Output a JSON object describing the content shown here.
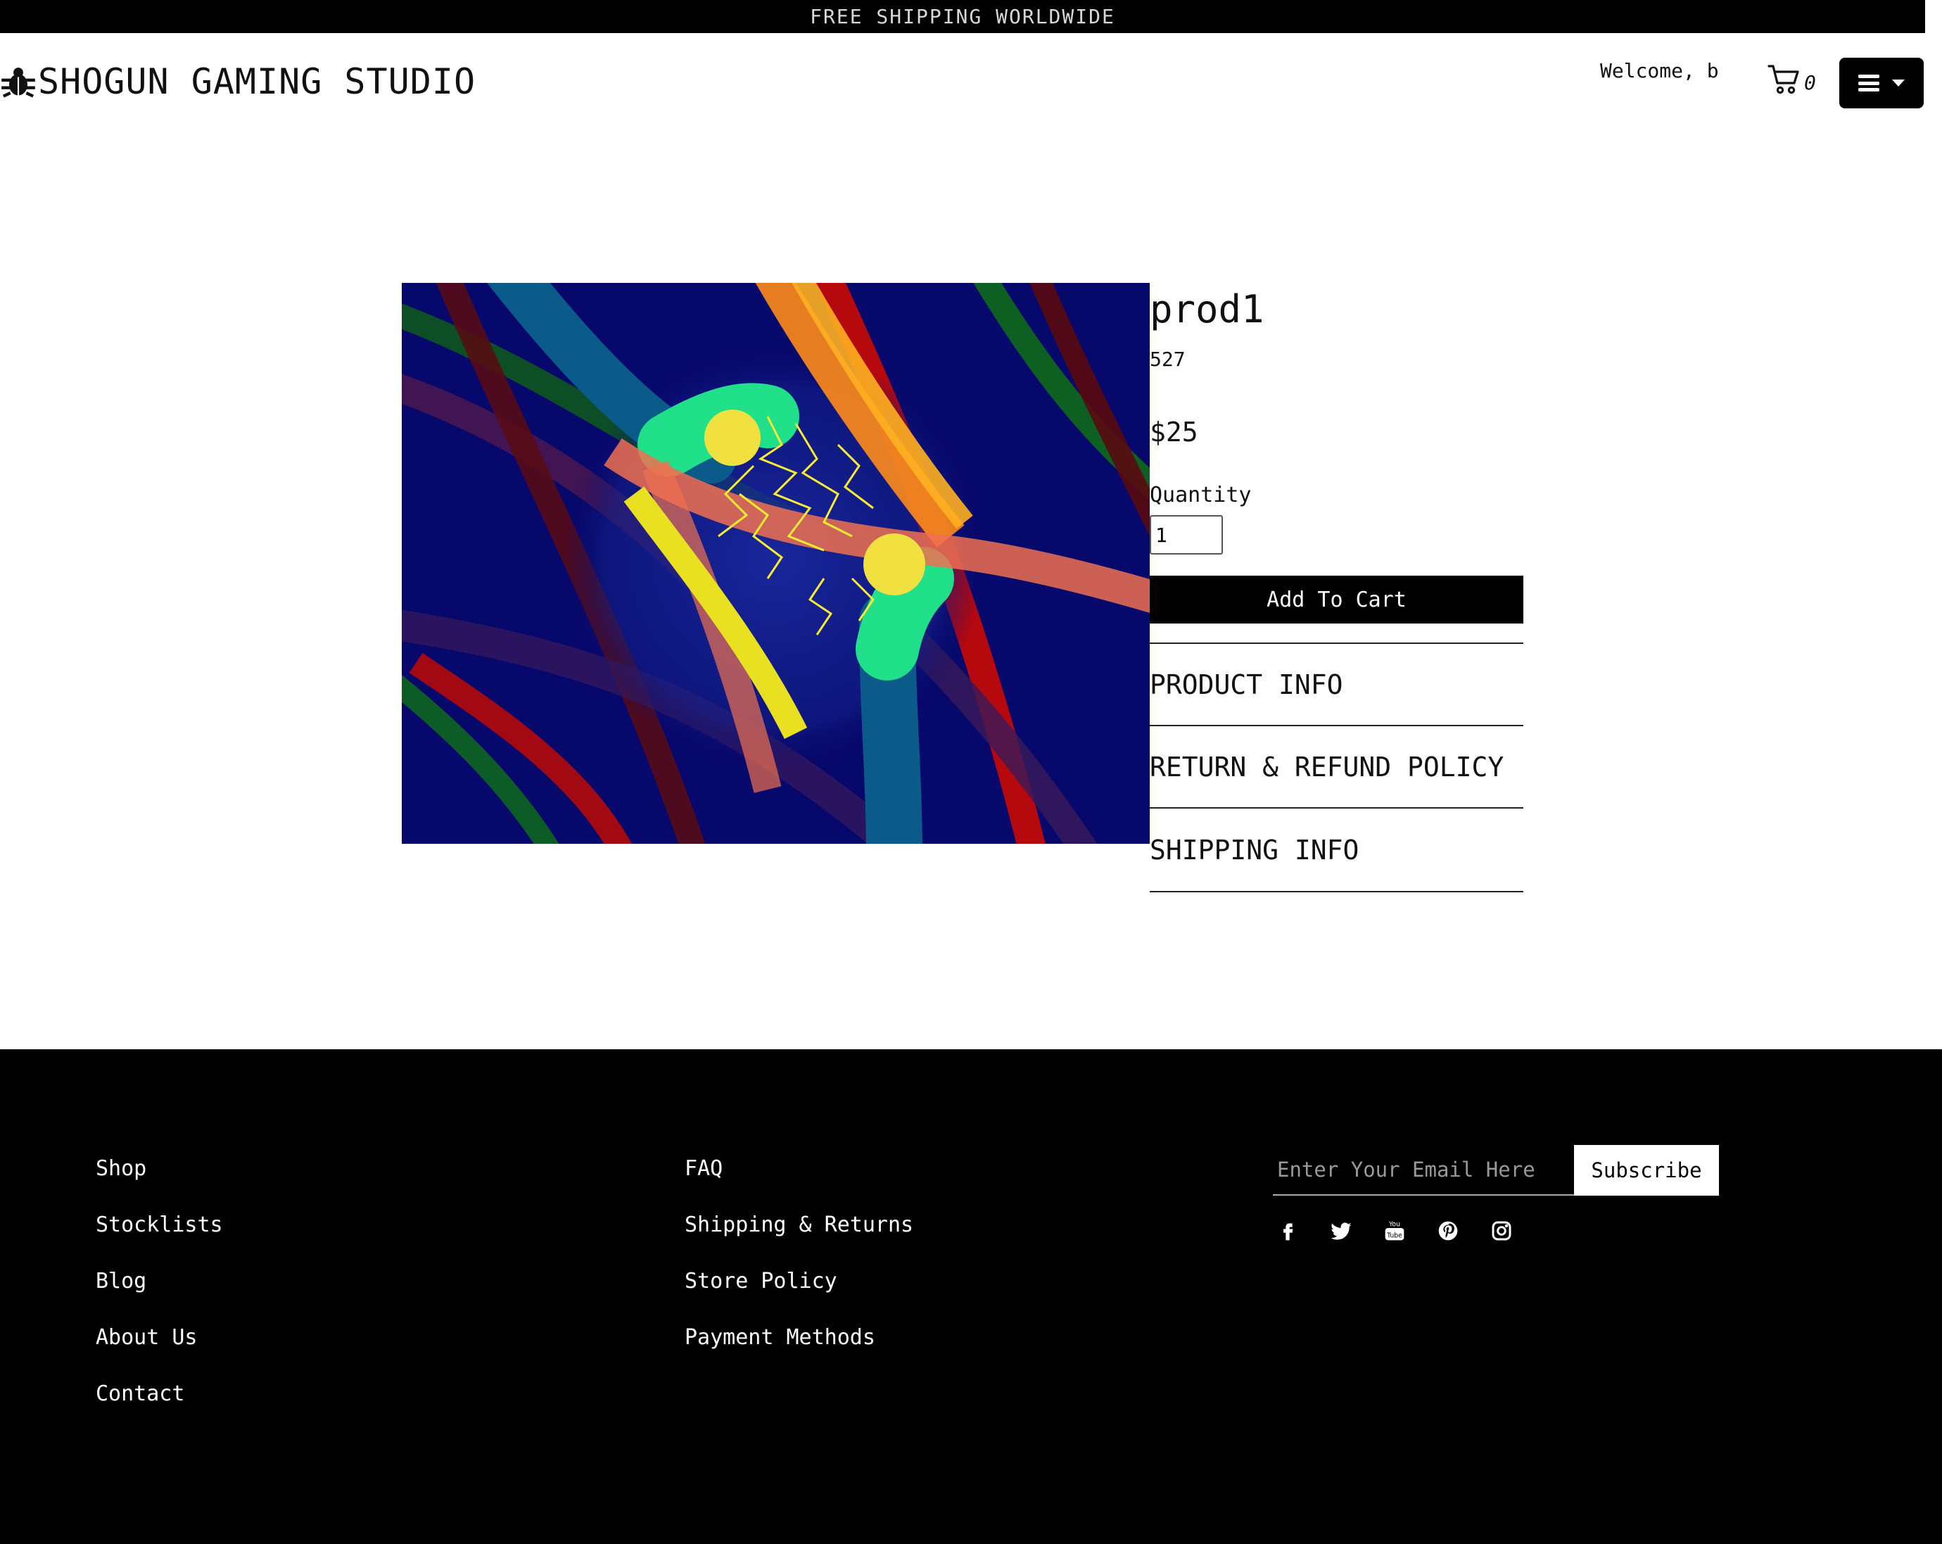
{
  "announcement": "FREE SHIPPING WORLDWIDE",
  "header": {
    "brand": "SHOGUN GAMING STUDIO",
    "welcome": "Welcome, b",
    "cart_count": "0"
  },
  "product": {
    "title": "prod1",
    "sku": "527",
    "price": "$25",
    "quantity_label": "Quantity",
    "quantity_value": "1",
    "add_to_cart": "Add To Cart",
    "accordion": [
      "PRODUCT INFO",
      "RETURN & REFUND POLICY",
      "SHIPPING INFO"
    ]
  },
  "footer": {
    "col1": [
      "Shop",
      "Stocklists",
      "Blog",
      "About Us",
      "Contact"
    ],
    "col2": [
      "FAQ",
      "Shipping & Returns",
      "Store Policy",
      "Payment Methods"
    ],
    "email_placeholder": "Enter Your Email Here",
    "subscribe": "Subscribe",
    "socials": [
      "facebook-icon",
      "twitter-icon",
      "youtube-icon",
      "pinterest-icon",
      "instagram-icon"
    ]
  }
}
